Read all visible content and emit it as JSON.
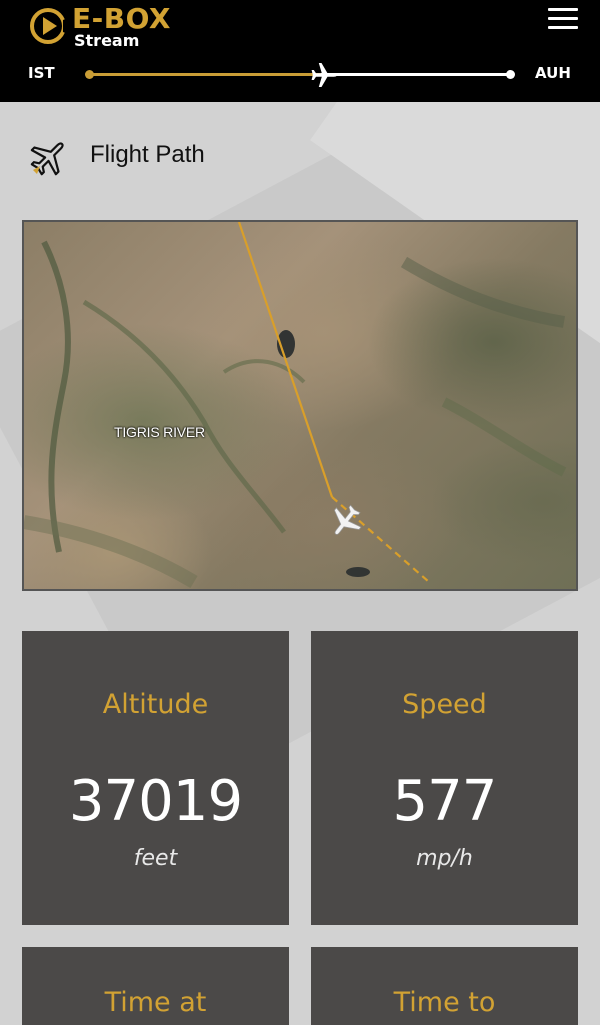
{
  "header": {
    "logo_title": "E-BOX",
    "logo_subtitle": "Stream",
    "route_origin": "IST",
    "route_destination": "AUH",
    "route_progress": 0.55
  },
  "flight_path": {
    "title": "Flight Path",
    "map_label": "TIGRIS RIVER"
  },
  "stats": {
    "altitude": {
      "label": "Altitude",
      "value": "37019",
      "unit": "feet"
    },
    "speed": {
      "label": "Speed",
      "value": "577",
      "unit": "mp/h"
    },
    "time_at": {
      "label": "Time at"
    },
    "time_to": {
      "label": "Time to"
    }
  },
  "colors": {
    "accent": "#d2a233",
    "header_bg": "#000000",
    "card_bg": "#4b4948",
    "page_bg": "#d2d2d2"
  }
}
